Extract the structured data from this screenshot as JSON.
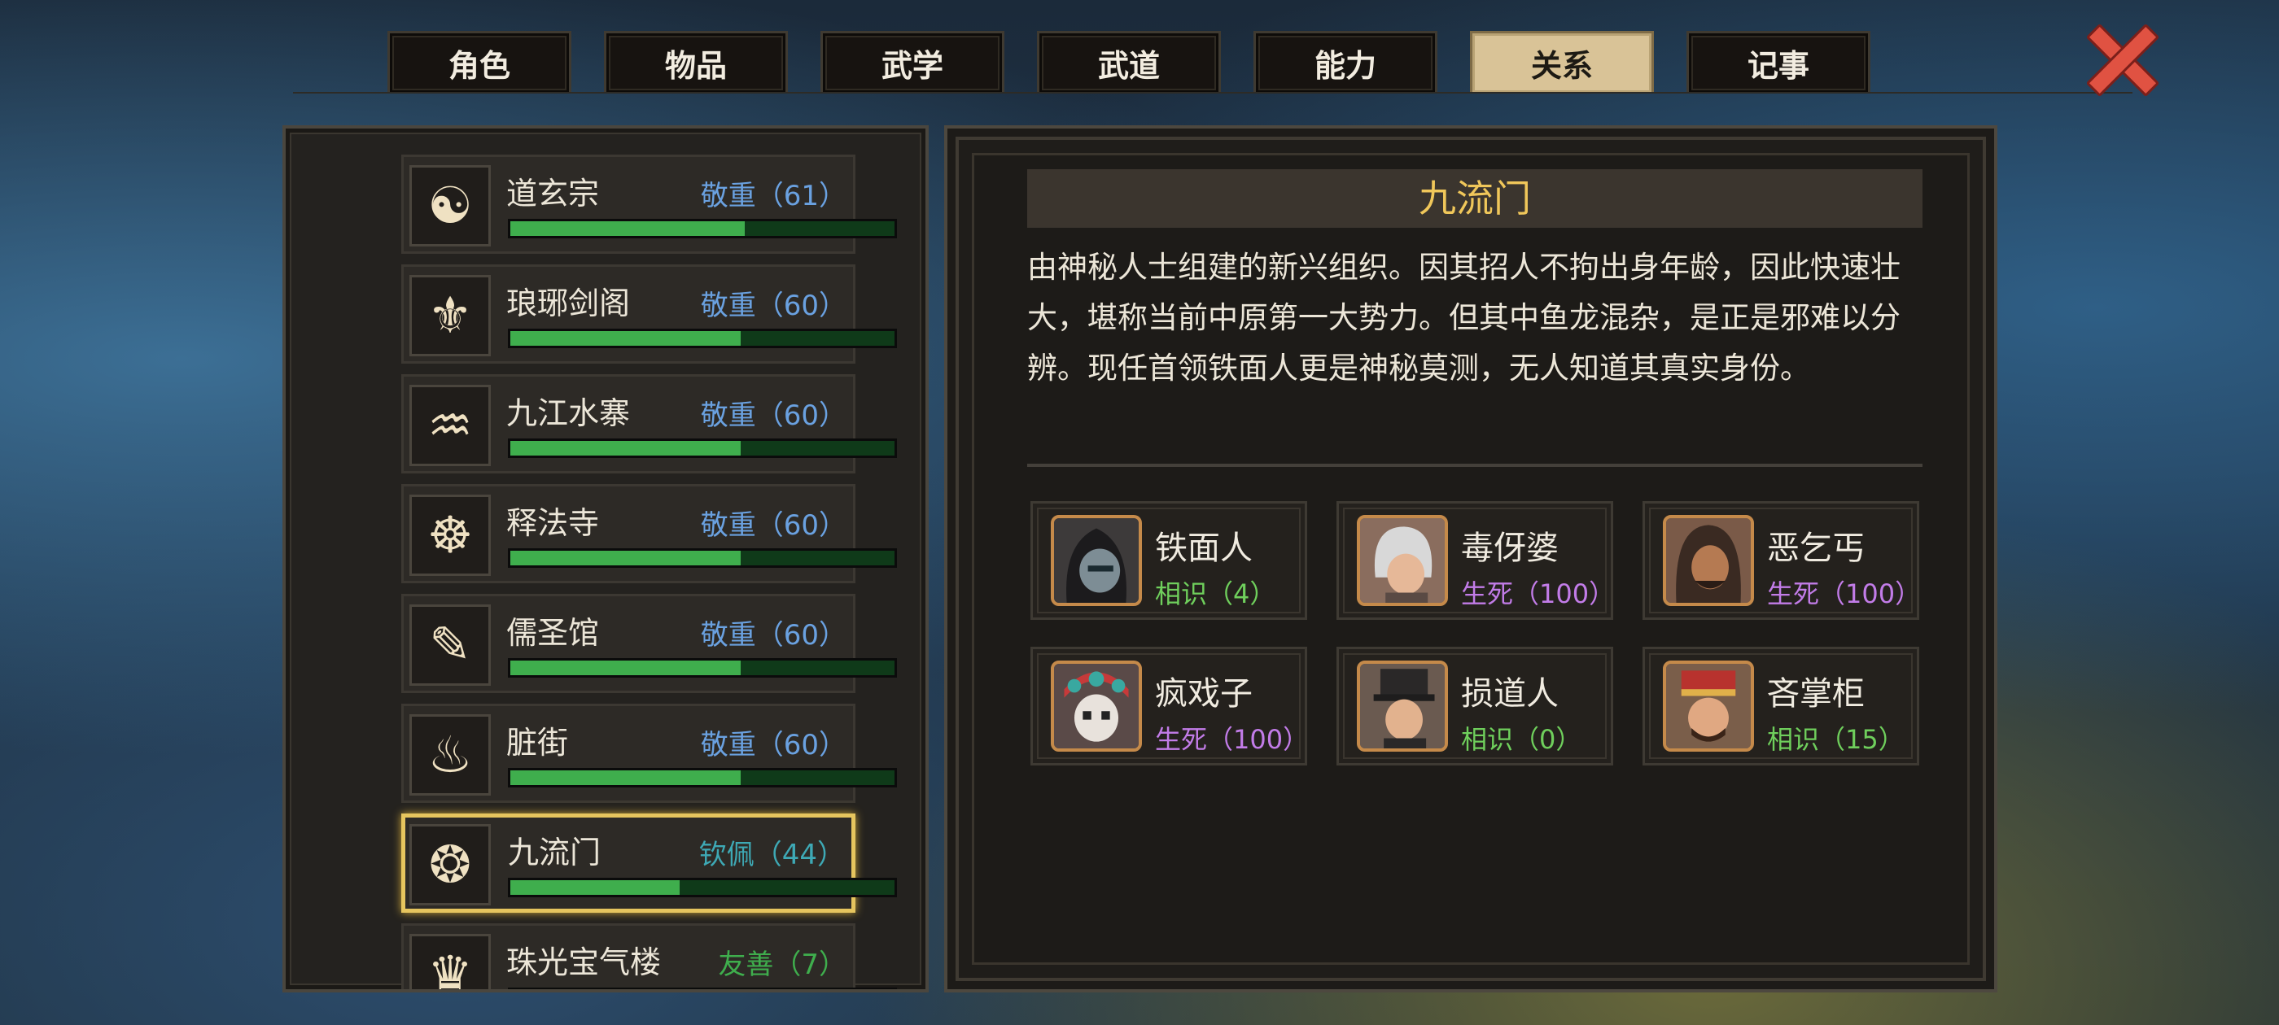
{
  "tabs": [
    {
      "label": "角色"
    },
    {
      "label": "物品"
    },
    {
      "label": "武学"
    },
    {
      "label": "武道"
    },
    {
      "label": "能力"
    },
    {
      "label": "关系",
      "active": true
    },
    {
      "label": "记事"
    }
  ],
  "factions": [
    {
      "name": "道玄宗",
      "status": "敬重（61）",
      "progress": 0.61,
      "icon": "swirl-emblem-icon",
      "glyph": "☯",
      "color": "#6aa1e0"
    },
    {
      "name": "琅琊剑阁",
      "status": "敬重（60）",
      "progress": 0.6,
      "icon": "sword-crest-icon",
      "glyph": "⚜",
      "color": "#6aa1e0"
    },
    {
      "name": "九江水寨",
      "status": "敬重（60）",
      "progress": 0.6,
      "icon": "water-fort-icon",
      "glyph": "♒",
      "color": "#6aa1e0"
    },
    {
      "name": "释法寺",
      "status": "敬重（60）",
      "progress": 0.6,
      "icon": "buddha-icon",
      "glyph": "☸",
      "color": "#6aa1e0"
    },
    {
      "name": "儒圣馆",
      "status": "敬重（60）",
      "progress": 0.6,
      "icon": "scroll-icon",
      "glyph": "✎",
      "color": "#6aa1e0"
    },
    {
      "name": "脏街",
      "status": "敬重（60）",
      "progress": 0.6,
      "icon": "beast-mask-icon",
      "glyph": "♨",
      "color": "#6aa1e0"
    },
    {
      "name": "九流门",
      "status": "钦佩（44）",
      "progress": 0.44,
      "icon": "triple-swirl-icon",
      "glyph": "❂",
      "color": "#3ea9b5",
      "selected": true
    },
    {
      "name": "珠光宝气楼",
      "status": "友善（7）",
      "progress": 0.07,
      "icon": "treasure-icon",
      "glyph": "♛",
      "color": "#3fae4d"
    }
  ],
  "detail": {
    "title": "九流门",
    "description": "由神秘人士组建的新兴组织。因其招人不拘出身年龄，因此快速壮大，堪称当前中原第一大势力。但其中鱼龙混杂，是正是邪难以分辨。现任首领铁面人更是神秘莫测，无人知道其真实身份。"
  },
  "members": [
    {
      "name": "铁面人",
      "relation": "相识（4）",
      "color": "#6fcf5c",
      "portrait": "iron-mask-portrait"
    },
    {
      "name": "毒伢婆",
      "relation": "生死（100）",
      "color": "#c27ce8",
      "portrait": "old-woman-portrait"
    },
    {
      "name": "恶乞丐",
      "relation": "生死（100）",
      "color": "#c27ce8",
      "portrait": "beggar-portrait"
    },
    {
      "name": "疯戏子",
      "relation": "生死（100）",
      "color": "#c27ce8",
      "portrait": "opera-mask-portrait"
    },
    {
      "name": "损道人",
      "relation": "相识（0）",
      "color": "#6fcf5c",
      "portrait": "taoist-portrait"
    },
    {
      "name": "吝掌柜",
      "relation": "相识（15）",
      "color": "#6fcf5c",
      "portrait": "shopkeeper-portrait"
    }
  ]
}
